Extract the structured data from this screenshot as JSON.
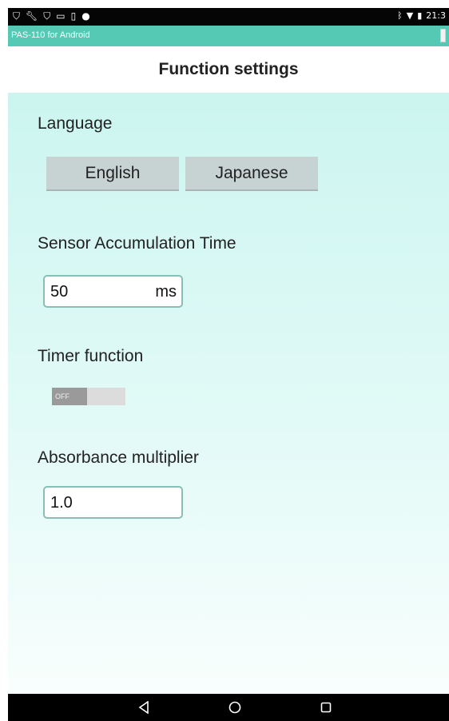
{
  "statusbar": {
    "left_icons": [
      "shield-icon",
      "wrench-icon",
      "shield-icon",
      "image-icon",
      "sim-icon",
      "android-icon"
    ],
    "right_icons": [
      "bluetooth-icon",
      "wifi-icon",
      "battery-icon"
    ],
    "time": "21:3"
  },
  "appbar": {
    "title": "PAS-110 for Android"
  },
  "header": {
    "title": "Function settings"
  },
  "language": {
    "label": "Language",
    "options": [
      "English",
      "Japanese"
    ]
  },
  "sensor": {
    "label": "Sensor Accumulation Time",
    "value": "50",
    "unit": "ms"
  },
  "timer": {
    "label": "Timer function",
    "state": "OFF"
  },
  "absorbance": {
    "label": "Absorbance multiplier",
    "value": "1.0"
  },
  "navbar": {
    "buttons": [
      "back-icon",
      "home-icon",
      "recents-icon"
    ]
  },
  "colors": {
    "accent": "#56c9b4",
    "background_top": "#ccf5f0",
    "button": "#c7d3d2"
  }
}
